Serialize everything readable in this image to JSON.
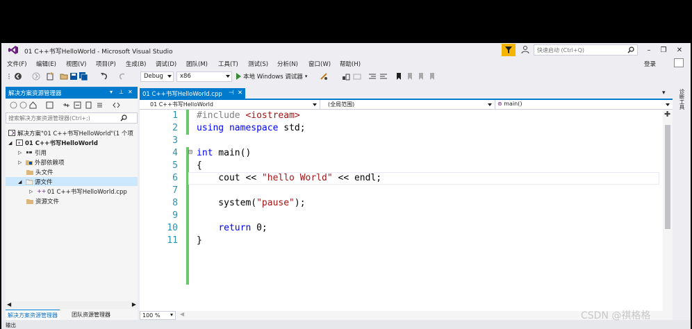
{
  "window": {
    "title": "01 C++书写HelloWorld - Microsoft Visual Studio",
    "quick_launch_placeholder": "快速启动 (Ctrl+Q)"
  },
  "menu": {
    "items": [
      "文件(F)",
      "编辑(E)",
      "视图(V)",
      "项目(P)",
      "生成(B)",
      "调试(D)",
      "团队(M)",
      "工具(T)",
      "测试(S)",
      "分析(N)",
      "窗口(W)",
      "帮助(H)"
    ],
    "login": "登录"
  },
  "toolbar": {
    "config": "Debug",
    "platform": "x86",
    "run_label": "本地 Windows 调试器"
  },
  "solution_explorer": {
    "title": "解决方案资源管理器",
    "search_placeholder": "搜索解决方案资源管理器(Ctrl+;)",
    "tree": [
      {
        "label": "解决方案\"01 C++书写HelloWorld\"(1 个项",
        "icon": "solution-icon"
      },
      {
        "label": "01 C++书写HelloWorld",
        "icon": "project-icon"
      },
      {
        "label": "引用",
        "icon": "references-icon"
      },
      {
        "label": "外部依赖项",
        "icon": "external-deps-icon"
      },
      {
        "label": "头文件",
        "icon": "folder-icon"
      },
      {
        "label": "源文件",
        "icon": "folder-icon"
      },
      {
        "label": "01 C++书写HelloWorld.cpp",
        "icon": "cpp-file-icon"
      },
      {
        "label": "资源文件",
        "icon": "folder-icon"
      }
    ],
    "tabs": [
      "解决方案资源管理器",
      "团队资源管理器"
    ]
  },
  "editor": {
    "tab_label": "01 C++书写HelloWorld.cpp",
    "nav_project": "01 C++书写HelloWorld",
    "nav_scope": "(全局范围)",
    "nav_member": "main()",
    "zoom": "100 %",
    "line_numbers": [
      "1",
      "2",
      "3",
      "4",
      "5",
      "6",
      "7",
      "8",
      "9",
      "10",
      "11"
    ]
  },
  "right_strip": {
    "label": "诊断工具"
  },
  "bottom": {
    "output_label": "输出"
  },
  "watermark": "CSDN @祺格格",
  "colors": {
    "accent": "#007acc",
    "keyword": "#0000ff",
    "string": "#a31515",
    "line_number": "#2b91af",
    "change_bar": "#6ac86a"
  }
}
